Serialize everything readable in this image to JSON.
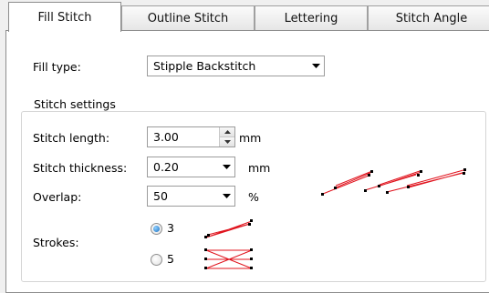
{
  "tabs": [
    {
      "label": "Fill Stitch",
      "active": true
    },
    {
      "label": "Outline Stitch",
      "active": false
    },
    {
      "label": "Lettering",
      "active": false
    },
    {
      "label": "Stitch Angle",
      "active": false
    }
  ],
  "fill_type": {
    "label": "Fill type:",
    "value": "Stipple Backstitch"
  },
  "stitch_settings": {
    "title": "Stitch settings",
    "stitch_length": {
      "label": "Stitch length:",
      "value": "3.00",
      "unit": "mm"
    },
    "stitch_thickness": {
      "label": "Stitch thickness:",
      "value": "0.20",
      "unit": "mm"
    },
    "overlap": {
      "label": "Overlap:",
      "value": "50",
      "unit": "%"
    },
    "strokes": {
      "label": "Strokes:",
      "options": [
        {
          "label": "3",
          "selected": true
        },
        {
          "label": "5",
          "selected": false
        }
      ]
    }
  },
  "colors": {
    "stitch_red": "#e0141e",
    "point_black": "#000000"
  },
  "icons": {
    "dropdown": "chevron-down-icon",
    "spin_up": "spin-up-icon",
    "spin_down": "spin-down-icon"
  }
}
